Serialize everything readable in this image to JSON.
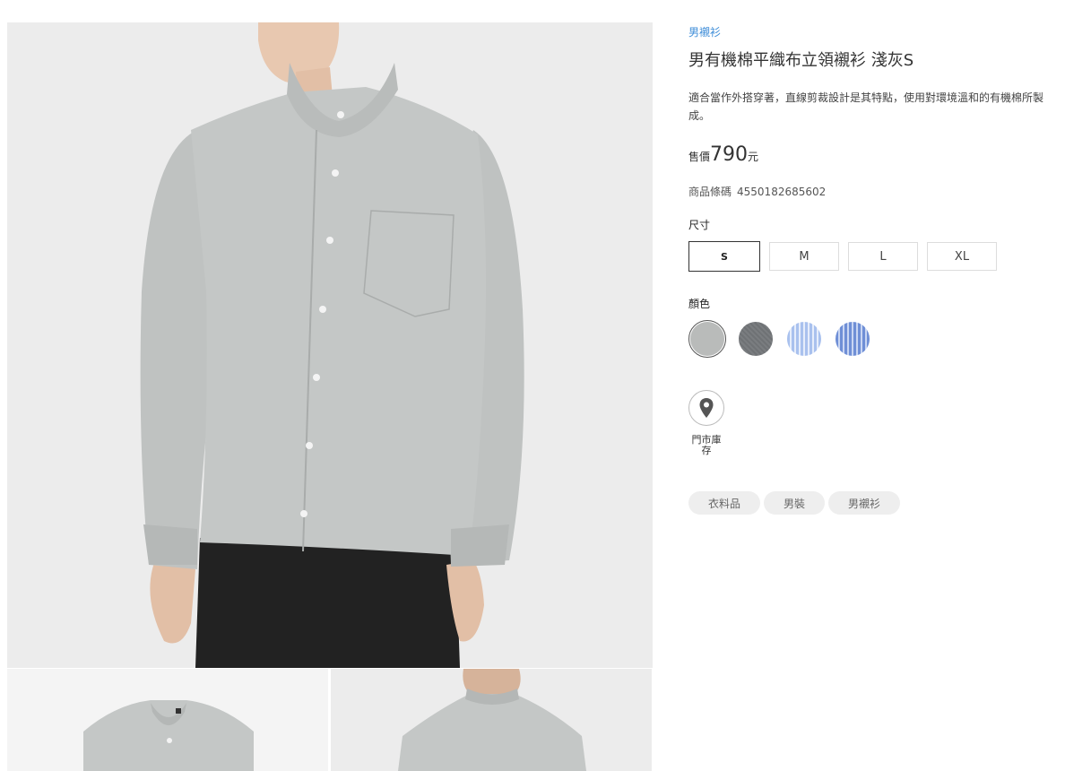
{
  "product": {
    "category": "男襯衫",
    "title": "男有機棉平織布立領襯衫 淺灰S",
    "description": "適合當作外搭穿著，直線剪裁設計是其特點，使用對環境溫和的有機棉所製成。",
    "price_label": "售價",
    "price_value": "790",
    "price_unit": "元",
    "barcode_label": "商品條碼",
    "barcode_value": "4550182685602"
  },
  "sizes": {
    "label": "尺寸",
    "options": [
      "S",
      "M",
      "L",
      "XL"
    ],
    "selected": "S"
  },
  "colors": {
    "label": "顏色",
    "swatches": [
      {
        "name": "light-gray",
        "hex": "#b9bbba",
        "selected": true
      },
      {
        "name": "dark-gray",
        "hex": "#6f7275",
        "selected": false
      },
      {
        "name": "light-blue-stripe",
        "hex": "#a9c1ee",
        "selected": false
      },
      {
        "name": "blue-stripe",
        "hex": "#6f8fd6",
        "selected": false
      }
    ]
  },
  "store_stock": {
    "icon": "map-pin-icon",
    "label": "門市庫存"
  },
  "tags": [
    "衣料品",
    "男裝",
    "男襯衫"
  ],
  "photos": {
    "main": "shirt-front-worn",
    "thumbnails": [
      "shirt-front-flat",
      "shirt-back-worn"
    ]
  },
  "accent_color": "#3f8ed8"
}
